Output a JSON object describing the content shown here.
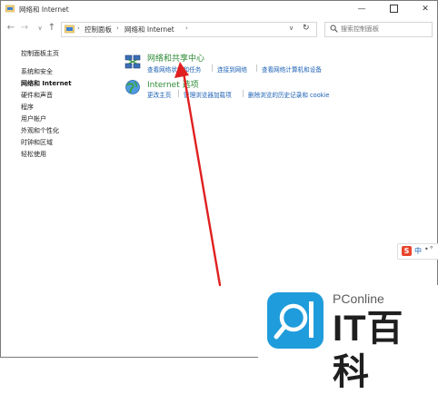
{
  "window": {
    "title": "网络和 Internet",
    "buttons": {
      "minimize": "—",
      "close": "✕"
    }
  },
  "toolbar": {
    "back": "←",
    "forward": "→",
    "recent": "∨",
    "up": "↑"
  },
  "address": {
    "crumbs": [
      "控制面板",
      "网络和 Internet"
    ],
    "separator": "›",
    "dropdown": "∨",
    "refresh": "↻"
  },
  "search": {
    "placeholder": "搜索控制面板"
  },
  "sidebar": {
    "home": "控制面板主页",
    "items": [
      "系统和安全",
      "网络和 Internet",
      "硬件和声音",
      "程序",
      "用户帐户",
      "外观和个性化",
      "时钟和区域",
      "轻松使用"
    ],
    "current_index": 1
  },
  "categories": [
    {
      "title": "网络和共享中心",
      "links": [
        "查看网络状态和任务",
        "连接到网络",
        "查看网络计算机和设备"
      ]
    },
    {
      "title": "Internet 选项",
      "links": [
        "更改主页",
        "管理浏览器加载项",
        "删除浏览的历史记录和 cookie"
      ]
    }
  ],
  "ime": {
    "logo": "S",
    "lang": "中",
    "extra": "•°"
  },
  "watermark": {
    "brand_small": "PConline",
    "brand_large": "IT百科"
  },
  "colors": {
    "category_title": "#2c8a36",
    "link": "#1a5fb4",
    "arrow": "#e02020",
    "watermark_blue": "#1f9cdb"
  },
  "icons": {
    "app": "control-panel-icon",
    "network": "network-sharing-icon",
    "internet": "internet-options-icon",
    "search": "search-icon"
  }
}
